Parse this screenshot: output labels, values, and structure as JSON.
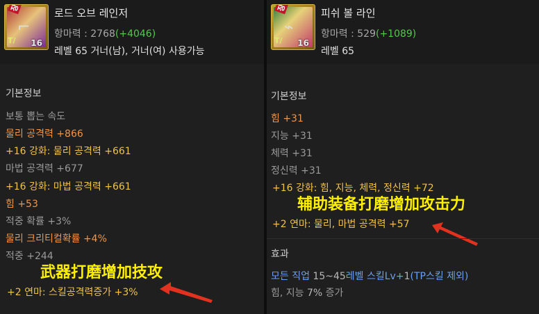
{
  "left": {
    "item_name": "로드 오브 레인저",
    "icon_badge": "장비",
    "icon_level": "16",
    "icon_tl": "T/",
    "attack_label": "항마력 : 2768",
    "attack_bonus": "(+4046)",
    "requirement": "레벨 65 거너(남), 거너(여) 사용가능",
    "section_title": "기본정보",
    "stats": [
      "보통 뽑는 속도",
      "물리 공격력 +866",
      " +16 강화: 물리 공격력 +661",
      "마법 공격력 +677",
      " +16 강화: 마법 공격력 +661",
      "힘 +53",
      "적중 확률 +3%",
      "물리 크리티컬확률 +4%",
      "적중 +244"
    ],
    "annotation": "武器打磨增加技攻",
    "polish_line": "+2 연마: 스킬공격력증가 +3%"
  },
  "right": {
    "item_name": "피쉬 볼 라인",
    "icon_badge": "장비",
    "icon_level": "16",
    "icon_tl": "T/",
    "attack_label": "항마력 : 529",
    "attack_bonus": "(+1089)",
    "requirement": "레벨 65",
    "section_title": "기본정보",
    "stats": [
      "힘 +31",
      "지능 +31",
      "체력 +31",
      "정신력 +31",
      "+16 강화: 힘, 지능, 체력, 정신력 +72"
    ],
    "annotation": "辅助装备打磨增加攻击力",
    "polish_line": "+2 연마: 물리, 마법 공격력 +57",
    "effect_title": "효과",
    "effect_line1_a": "모든 직업 ",
    "effect_line1_b": "15~45",
    "effect_line1_c": "레벨 스킬Lv+",
    "effect_line1_d": "1",
    "effect_line1_e": "(TP스킬 제외)",
    "effect_line2_a": "힘, 지능 ",
    "effect_line2_b": "7%",
    "effect_line2_c": " 증가"
  },
  "colors": {
    "background": "#1f1f1f",
    "stat_grey": "#9a9a9a",
    "stat_orange": "#f29544",
    "enhance_yellow": "#f0c24a",
    "bonus_green": "#52c84a",
    "annotation_yellow": "#fff000",
    "arrow_red": "#e0321e",
    "effect_blue": "#6c9ff0"
  }
}
